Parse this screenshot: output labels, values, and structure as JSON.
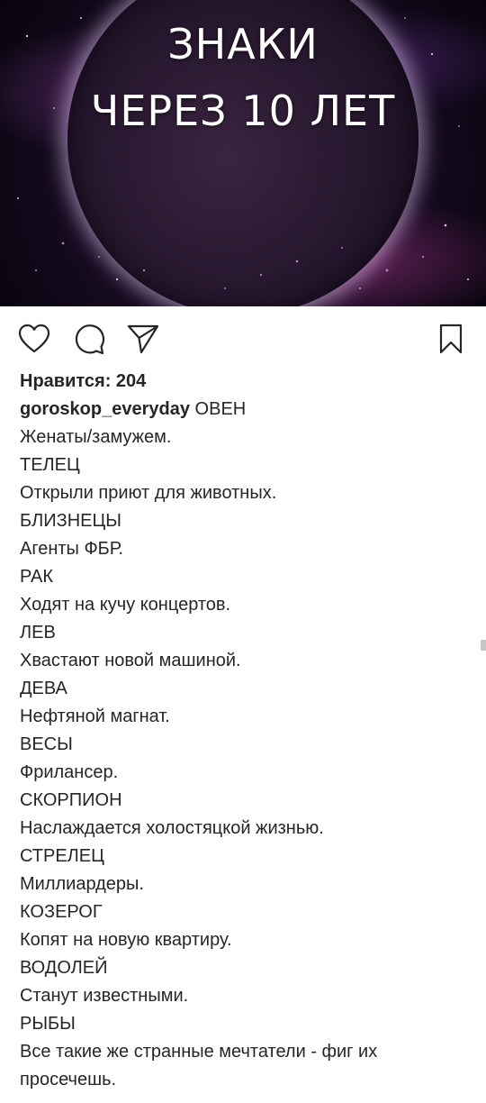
{
  "post_image": {
    "title_line_1": "ЗНАКИ",
    "title_line_2": "ЧЕРЕЗ 10 ЛЕТ"
  },
  "actions": {
    "like_icon": "heart-icon",
    "comment_icon": "speech-bubble-icon",
    "share_icon": "paper-plane-icon",
    "save_icon": "bookmark-icon"
  },
  "likes": {
    "label": "Нравится:",
    "count": "204"
  },
  "caption": {
    "username": "goroskop_everyday",
    "lines": [
      "ОВЕН",
      "Женаты/замужем.",
      "ТЕЛЕЦ",
      "Открыли приют для животных.",
      "БЛИЗНЕЦЫ",
      "Агенты ФБР.",
      "РАК",
      "Ходят на кучу концертов.",
      "ЛЕВ",
      "Хвастают новой машиной.",
      "ДЕВА",
      "Нефтяной магнат.",
      "ВЕСЫ",
      "Фрилансер.",
      "СКОРПИОН",
      "Наслаждается холостяцкой жизнью.",
      "СТРЕЛЕЦ",
      "Миллиардеры.",
      "КОЗЕРОГ",
      "Копят на новую квартиру.",
      "ВОДОЛЕЙ",
      "Станут известными.",
      "РЫБЫ",
      "Все такие же странные мечтатели - фиг их просечешь."
    ]
  },
  "colors": {
    "text": "#262626",
    "background": "#ffffff",
    "image_glow": "#e9d5ff"
  }
}
